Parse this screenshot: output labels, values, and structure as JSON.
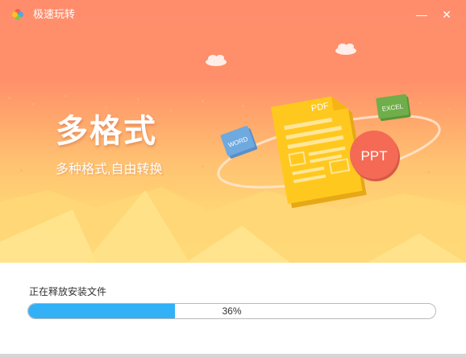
{
  "window": {
    "title": "极速玩转",
    "minimize_icon": "minimize-icon",
    "close_icon": "close-icon",
    "minimize_glyph": "—",
    "close_glyph": "✕"
  },
  "banner": {
    "headline": "多格式",
    "subline": "多种格式,自由转换",
    "illustration": {
      "center_doc_label": "PDF",
      "left_badge_label": "WORD",
      "top_badge_label": "EXCEL",
      "right_badge_label": "PPT"
    },
    "colors": {
      "sky": "#ff8d6c",
      "sand": "#ffd374",
      "pdf_doc": "#ffc81e",
      "word_badge": "#6ea9df",
      "excel_badge": "#6fae4a",
      "ppt_badge": "#f46a55"
    }
  },
  "install": {
    "status": "正在释放安装文件",
    "progress": 0.36,
    "progress_label": "36%",
    "progress_color": "#33b1f6"
  }
}
